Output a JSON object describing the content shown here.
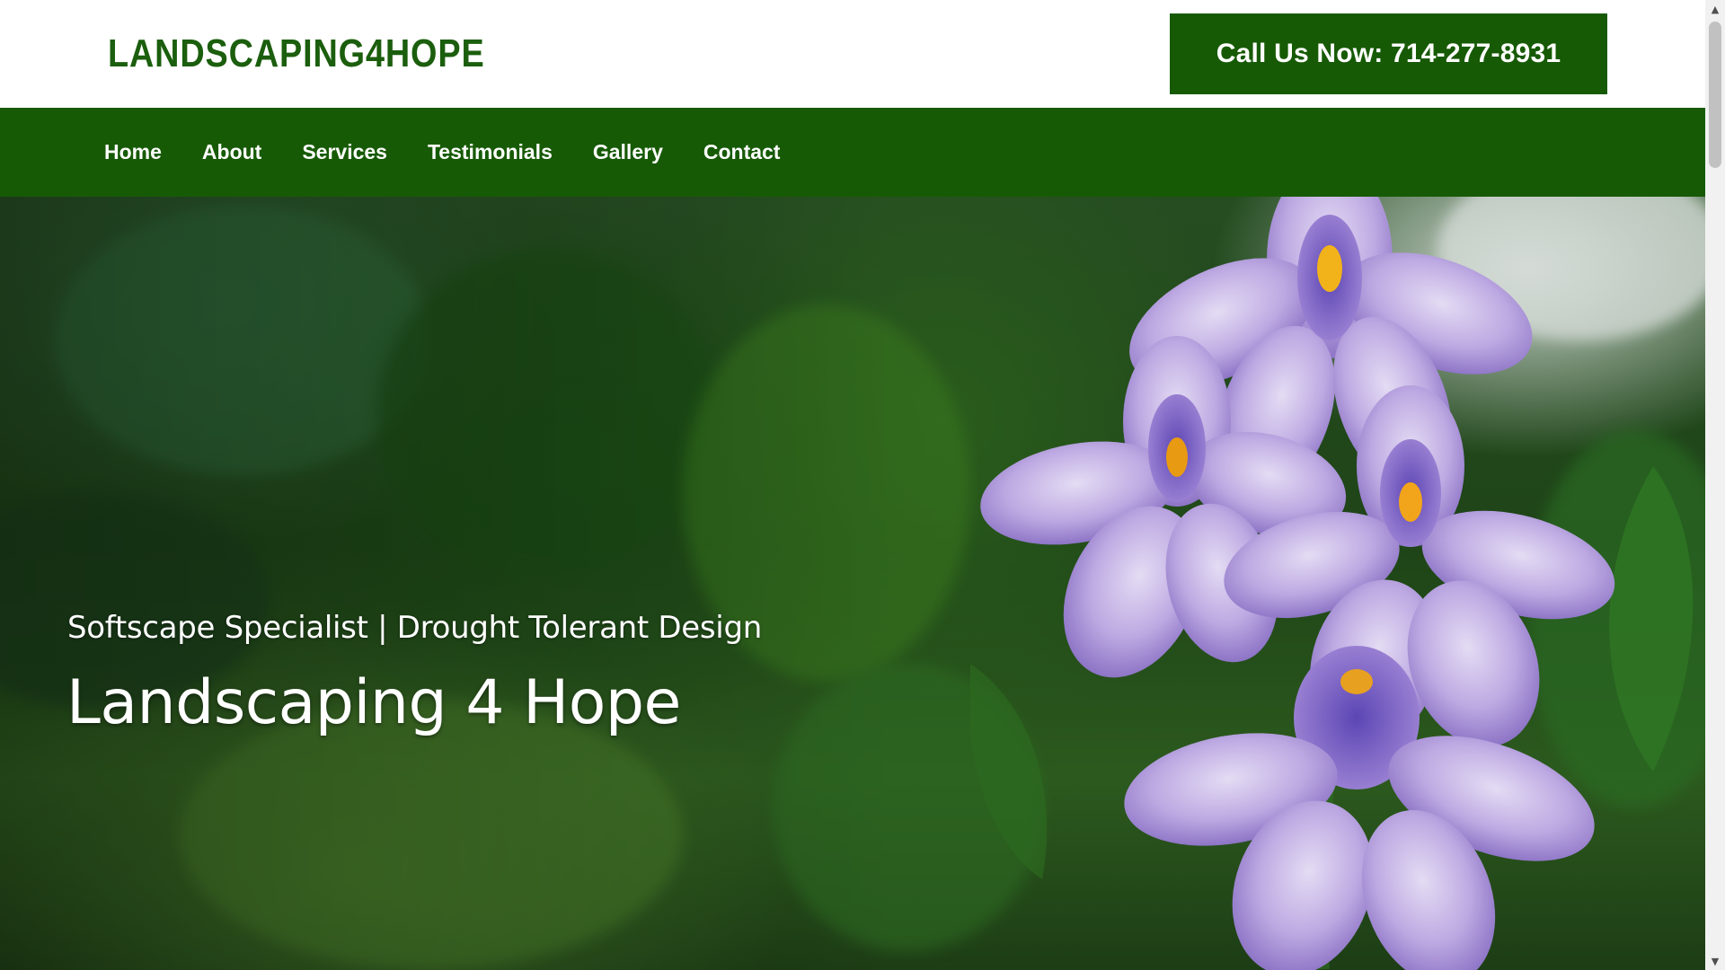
{
  "header": {
    "logo_text": "LANDSCAPING4HOPE",
    "call_button_label": "Call Us Now: 714-277-8931"
  },
  "nav": {
    "items": [
      {
        "label": "Home"
      },
      {
        "label": "About"
      },
      {
        "label": "Services"
      },
      {
        "label": "Testimonials"
      },
      {
        "label": "Gallery"
      },
      {
        "label": "Contact"
      }
    ]
  },
  "hero": {
    "subtitle": "Softscape Specialist | Drought Tolerant Design",
    "title": "Landscaping 4 Hope",
    "image_subject": "purple water hyacinth flowers"
  },
  "colors": {
    "brand_green": "#175a05",
    "logo_green": "#1b5e0d",
    "text_on_green": "#ffffff"
  },
  "icons": {
    "scroll_up": "chevron-up-icon",
    "scroll_down": "chevron-down-icon"
  }
}
